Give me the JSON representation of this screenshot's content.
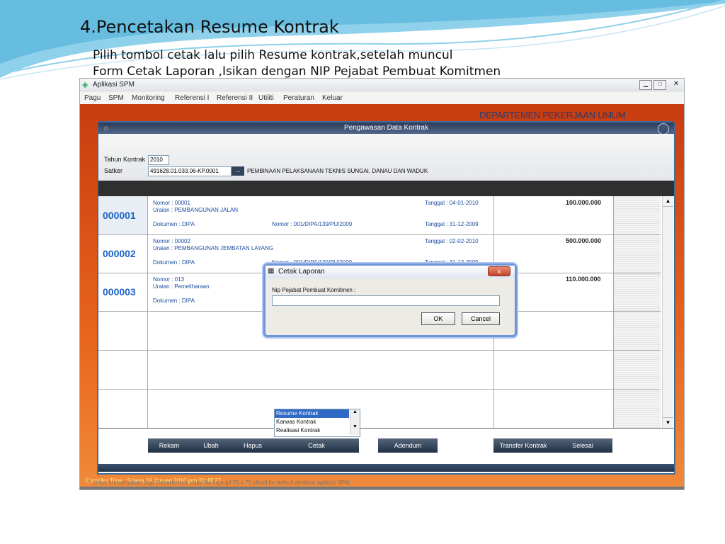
{
  "slide": {
    "title": "4.Pencetakan Resume Kontrak",
    "line1": "Pilih tombol cetak lalu pilih Resume kontrak,setelah muncul",
    "line2": "Form Cetak Laporan ,Isikan dengan NIP Pejabat Pembuat Komitmen"
  },
  "window": {
    "title": "Aplikasi SPM",
    "menu": [
      "Pagu",
      "SPM",
      "Monitoring",
      "Referensi I",
      "Referensi II",
      "Utiliti",
      "Peraturan",
      "Keluar"
    ],
    "banner": "DEPARTEMEN PEKERJAAN UMUM",
    "footer_note": "* Untuk menampilkan logo Departemen, copy file logo.gif 75 x 75 piksel ke default direktori aplikasi SPM.",
    "footer_partial": "Compiler Time : Selasa,19 Januari 2010 jam 20:48:27"
  },
  "form": {
    "title": "Pengawasan Data Kontrak",
    "tahun_label": "Tahun Kontrak",
    "tahun_value": "2010",
    "satker_label": "Satker",
    "satker_value": "491628.01.033.06-KP.0001",
    "satker_browse": "...",
    "satker_name": "PEMBINAAN PELAKSANAAN TEKNIS SUNGAI, DANAU DAN WADUK",
    "rows": [
      {
        "num": "000001",
        "nomor": "Nomor : 00001",
        "uraian": "Uraian : PEMBANGUNAN JALAN",
        "dokumen": "Dokumen      : DIPA",
        "nomor_dipa": "Nomor :  001/DIPA/139/PU/2009",
        "tanggal1": "Tanggal : 04-01-2010",
        "tanggal2": "Tanggal : 31-12-2009",
        "amount": "100.000.000"
      },
      {
        "num": "000002",
        "nomor": "Nomor : 00002",
        "uraian": "Uraian : PEMBANGUNAN JEMBATAN LAYANG",
        "dokumen": "Dokumen      : DIPA",
        "nomor_dipa": "Nomor :  001/DIPA/139/PU/2009",
        "tanggal1": "Tanggal : 02-02-2010",
        "tanggal2": "Tanggal : 31-12-2009",
        "amount": "500.000.000"
      },
      {
        "num": "000003",
        "nomor": "Nomor : 013",
        "uraian": "Uraian : Pemeliharaan",
        "dokumen": "Dokumen      : DIPA",
        "amount": "110.000.000"
      }
    ],
    "buttons": {
      "rekam": "Rekam",
      "ubah": "Ubah",
      "hapus": "Hapus",
      "cetak": "Cetak",
      "adendum": "Adendum",
      "transfer": "Transfer Kontrak",
      "selesai": "Selesai"
    },
    "cetak_options": [
      "Resume Kontrak",
      "Karwas Kontrak",
      "Realisasi Kontrak"
    ]
  },
  "dialog": {
    "title": "Cetak Laporan",
    "label": "Nip Pejabat Pembuat Komitmen :",
    "input_value": "",
    "ok": "OK",
    "cancel": "Cancel",
    "close": "x"
  },
  "colors": {
    "accent": "#1c64c8",
    "banner_bg": "#d84f1a"
  }
}
